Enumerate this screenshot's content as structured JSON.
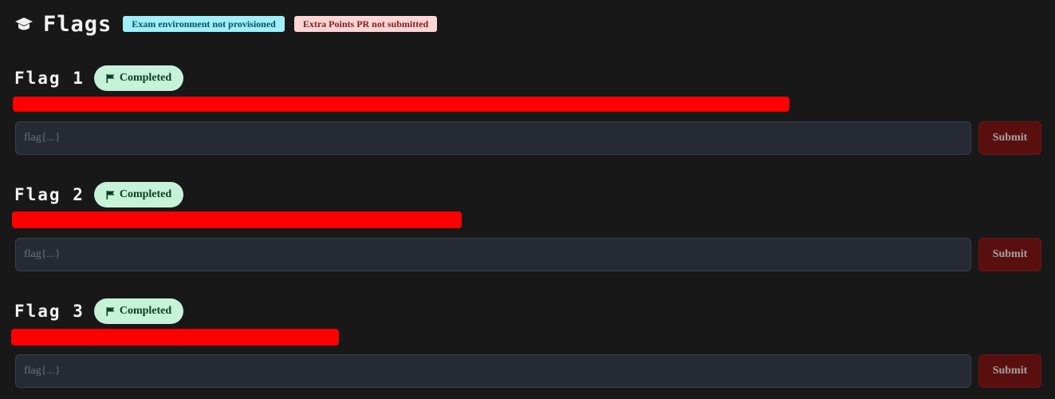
{
  "header": {
    "title": "Flags",
    "icon": "graduation-cap-icon",
    "badges": {
      "exam": "Exam environment not provisioned",
      "extra": "Extra Points PR not submitted"
    }
  },
  "flags": [
    {
      "title": "Flag 1",
      "status": "Completed",
      "placeholder": "flag{...}",
      "submit_label": "Submit"
    },
    {
      "title": "Flag 2",
      "status": "Completed",
      "placeholder": "flag{...}",
      "submit_label": "Submit"
    },
    {
      "title": "Flag 3",
      "status": "Completed",
      "placeholder": "flag{...}",
      "submit_label": "Submit"
    }
  ],
  "colors": {
    "background": "#181818",
    "redaction": "#ff0000",
    "completed_bg": "#c5f2d9",
    "submit_bg": "#5a0f0f"
  }
}
